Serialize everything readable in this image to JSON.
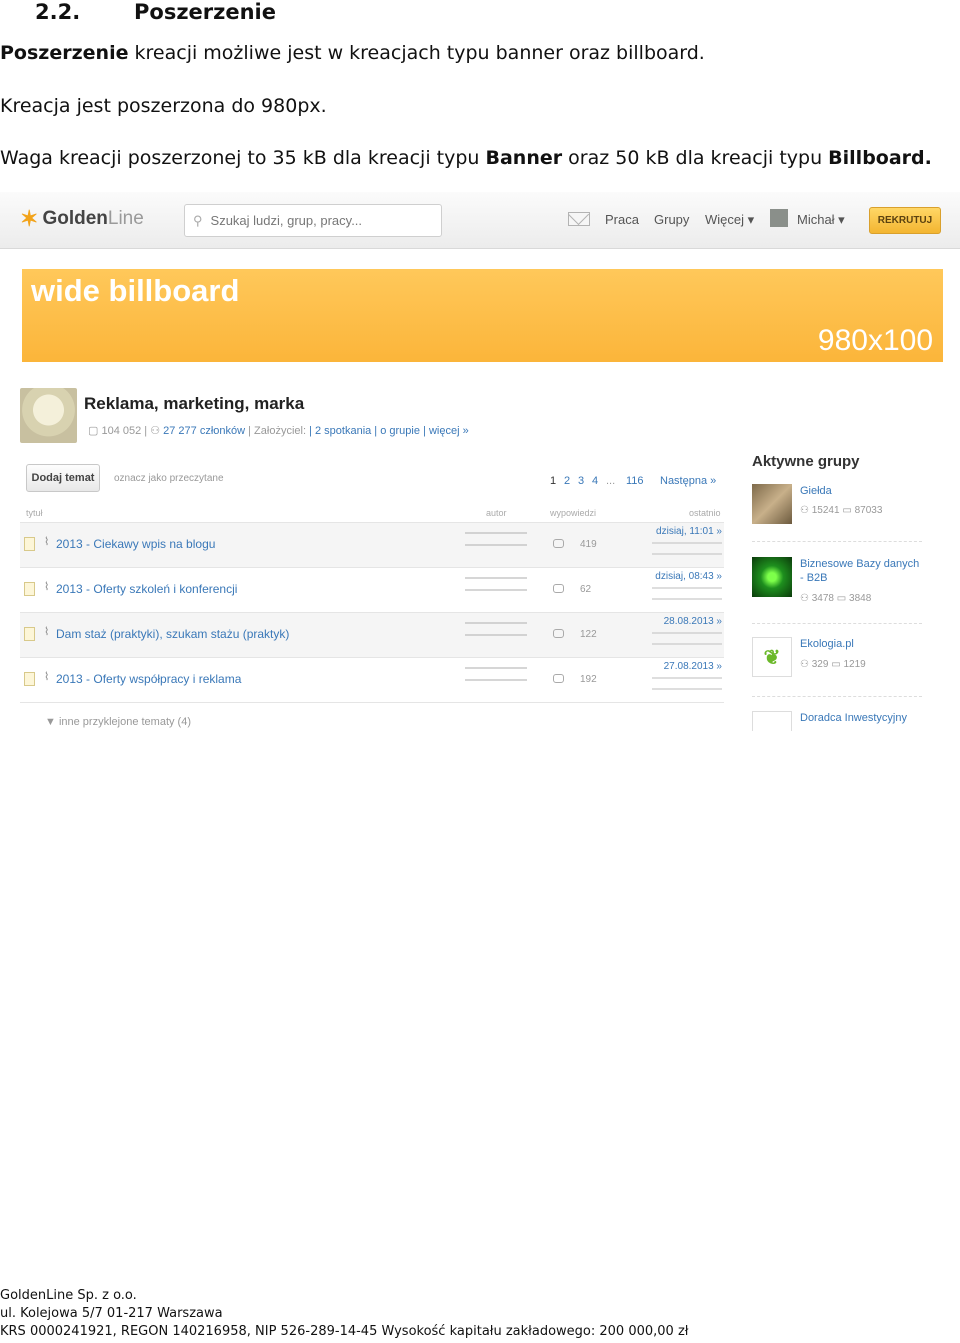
{
  "section": {
    "number": "2.2.",
    "title": "Poszerzenie"
  },
  "paragraphs": {
    "p1_bold": "Poszerzenie",
    "p1_rest": " kreacji możliwe jest w kreacjach typu banner oraz billboard.",
    "p2": "Kreacja jest poszerzona do 980px.",
    "p3_a": "Waga kreacji poszerzonej to 35 kB dla kreacji typu ",
    "p3_b": "Banner",
    "p3_c": " oraz 50 kB dla kreacji typu ",
    "p3_d": "Billboard."
  },
  "screenshot": {
    "logo": {
      "golden": "Golden",
      "line": "Line"
    },
    "search_placeholder": "Szukaj ludzi, grup, pracy...",
    "nav": {
      "praca": "Praca",
      "grupy": "Grupy",
      "wiecej": "Więcej ▾",
      "user": "Michał ▾",
      "rekrutuj": "REKRUTUJ"
    },
    "billboard": {
      "title": "wide billboard",
      "size": "980x100"
    },
    "group": {
      "title": "Reklama, marketing, marka",
      "views": "104 052 |",
      "members": "27 277 członków",
      "founder_label": "| Założyciel:",
      "links": "| 2 spotkania | o grupie | więcej »"
    },
    "toolbar": {
      "add_topic": "Dodaj temat",
      "mark_read": "oznacz jako przeczytane"
    },
    "pager": {
      "p1": "1",
      "p2": "2",
      "p3": "3",
      "p4": "4",
      "dots": "...",
      "last": "116",
      "next": "Następna »"
    },
    "columns": {
      "title": "tytuł",
      "author": "autor",
      "replies": "wypowiedzi",
      "last": "ostatnio"
    },
    "topics": [
      {
        "title": "2013 - Ciekawy wpis na blogu",
        "count": "419",
        "last": "dzisiaj, 11:01 »"
      },
      {
        "title": "2013 - Oferty szkoleń i konferencji",
        "count": "62",
        "last": "dzisiaj, 08:43 »"
      },
      {
        "title": "Dam staż (praktyki), szukam stażu (praktyk)",
        "count": "122",
        "last": "28.08.2013 »"
      },
      {
        "title": "2013 - Oferty współpracy i reklama",
        "count": "192",
        "last": "27.08.2013 »"
      }
    ],
    "more_topics": "▼ inne przyklejone tematy (4)",
    "sidebar": {
      "title": "Aktywne grupy",
      "groups": [
        {
          "name": "Giełda",
          "members": "15241",
          "posts": "87033"
        },
        {
          "name": "Biznesowe Bazy danych - B2B",
          "members": "3478",
          "posts": "3848"
        },
        {
          "name": "Ekologia.pl",
          "members": "329",
          "posts": "1219"
        },
        {
          "name": "Doradca Inwestycyjny"
        }
      ]
    }
  },
  "footer": {
    "line1": "GoldenLine Sp. z o.o.",
    "line2": "ul. Kolejowa 5/7  01-217 Warszawa",
    "line3": "KRS 0000241921, REGON 140216958, NIP 526-289-14-45 Wysokość kapitału zakładowego: 200 000,00 zł"
  }
}
